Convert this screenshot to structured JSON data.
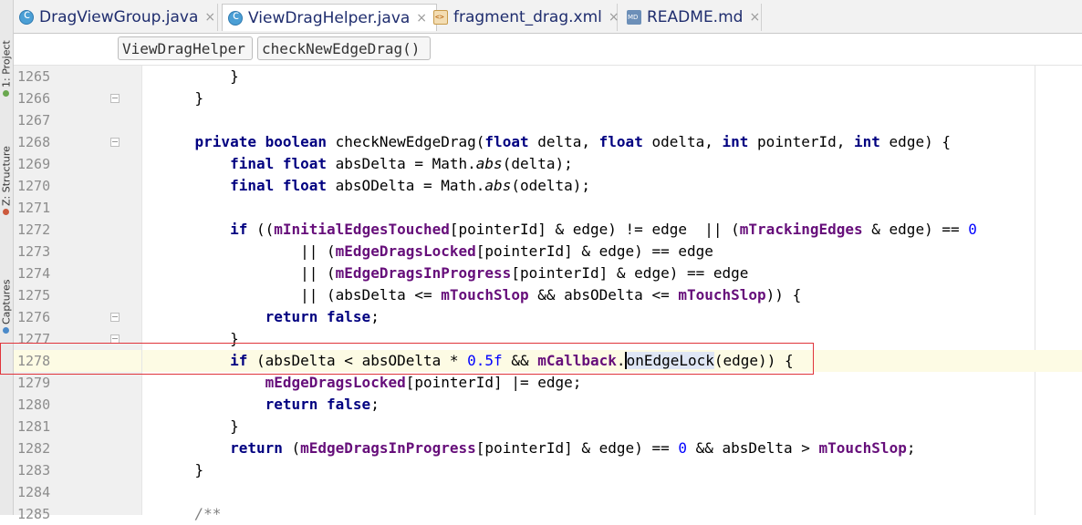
{
  "tool_strip": [
    {
      "label": "1: Project",
      "dot": "#6aa84f"
    },
    {
      "label": "Z: Structure",
      "dot": "#cc5a3d"
    },
    {
      "label": "Captures",
      "dot": "#4b8ac9"
    }
  ],
  "tabs": [
    {
      "label": "DragViewGroup.java",
      "icon": "java-class-icon",
      "active": false,
      "close": "×"
    },
    {
      "label": "ViewDragHelper.java",
      "icon": "java-class-icon",
      "active": true,
      "close": "×"
    },
    {
      "label": "fragment_drag.xml",
      "icon": "xml-file-icon",
      "active": false,
      "close": "×"
    },
    {
      "label": "README.md",
      "icon": "markdown-file-icon",
      "active": false,
      "close": "×"
    }
  ],
  "breadcrumb": [
    "ViewDragHelper",
    "checkNewEdgeDrag()"
  ],
  "editor": {
    "line_numbers": [
      "1265",
      "1266",
      "1267",
      "1268",
      "1269",
      "1270",
      "1271",
      "1272",
      "1273",
      "1274",
      "1275",
      "1276",
      "1277",
      "1278",
      "1279",
      "1280",
      "1281",
      "1282",
      "1283",
      "1284",
      "1285"
    ],
    "current_line": "1278",
    "lines": [
      [
        {
          "t": "        }"
        }
      ],
      [
        {
          "t": "    }"
        }
      ],
      [
        {
          "t": ""
        }
      ],
      [
        {
          "t": "    "
        },
        {
          "t": "private boolean ",
          "c": "kw"
        },
        {
          "t": "checkNewEdgeDrag("
        },
        {
          "t": "float ",
          "c": "kw"
        },
        {
          "t": "delta, "
        },
        {
          "t": "float ",
          "c": "kw"
        },
        {
          "t": "odelta, "
        },
        {
          "t": "int ",
          "c": "kw"
        },
        {
          "t": "pointerId, "
        },
        {
          "t": "int ",
          "c": "kw"
        },
        {
          "t": "edge) {"
        }
      ],
      [
        {
          "t": "        "
        },
        {
          "t": "final float ",
          "c": "kw"
        },
        {
          "t": "absDelta = Math."
        },
        {
          "t": "abs",
          "c": "static"
        },
        {
          "t": "(delta);"
        }
      ],
      [
        {
          "t": "        "
        },
        {
          "t": "final float ",
          "c": "kw"
        },
        {
          "t": "absODelta = Math."
        },
        {
          "t": "abs",
          "c": "static"
        },
        {
          "t": "(odelta);"
        }
      ],
      [
        {
          "t": ""
        }
      ],
      [
        {
          "t": "        "
        },
        {
          "t": "if ",
          "c": "kw"
        },
        {
          "t": "(("
        },
        {
          "t": "mInitialEdgesTouched",
          "c": "fld"
        },
        {
          "t": "[pointerId] & edge) != edge  || ("
        },
        {
          "t": "mTrackingEdges",
          "c": "fld"
        },
        {
          "t": " & edge) == "
        },
        {
          "t": "0",
          "c": "num-lit"
        }
      ],
      [
        {
          "t": "                || ("
        },
        {
          "t": "mEdgeDragsLocked",
          "c": "fld"
        },
        {
          "t": "[pointerId] & edge) == edge"
        }
      ],
      [
        {
          "t": "                || ("
        },
        {
          "t": "mEdgeDragsInProgress",
          "c": "fld"
        },
        {
          "t": "[pointerId] & edge) == edge"
        }
      ],
      [
        {
          "t": "                || (absDelta <= "
        },
        {
          "t": "mTouchSlop",
          "c": "fld"
        },
        {
          "t": " && absODelta <= "
        },
        {
          "t": "mTouchSlop",
          "c": "fld"
        },
        {
          "t": ")) {"
        }
      ],
      [
        {
          "t": "            "
        },
        {
          "t": "return false",
          "c": "kw"
        },
        {
          "t": ";"
        }
      ],
      [
        {
          "t": "        }"
        }
      ],
      [
        {
          "t": "        "
        },
        {
          "t": "if ",
          "c": "kw"
        },
        {
          "t": "(absDelta < absODelta * "
        },
        {
          "t": "0.5f",
          "c": "num-lit"
        },
        {
          "t": " && "
        },
        {
          "t": "mCallback",
          "c": "fld"
        },
        {
          "t": "."
        },
        {
          "t": "onEdgeLock",
          "c": "hl caret"
        },
        {
          "t": "(edge)) {"
        }
      ],
      [
        {
          "t": "            "
        },
        {
          "t": "mEdgeDragsLocked",
          "c": "fld"
        },
        {
          "t": "[pointerId] |= edge;"
        }
      ],
      [
        {
          "t": "            "
        },
        {
          "t": "return false",
          "c": "kw"
        },
        {
          "t": ";"
        }
      ],
      [
        {
          "t": "        }"
        }
      ],
      [
        {
          "t": "        "
        },
        {
          "t": "return ",
          "c": "kw"
        },
        {
          "t": "("
        },
        {
          "t": "mEdgeDragsInProgress",
          "c": "fld"
        },
        {
          "t": "[pointerId] & edge) == "
        },
        {
          "t": "0",
          "c": "num-lit"
        },
        {
          "t": " && absDelta > "
        },
        {
          "t": "mTouchSlop",
          "c": "fld"
        },
        {
          "t": ";"
        }
      ],
      [
        {
          "t": "    }"
        }
      ],
      [
        {
          "t": ""
        }
      ],
      [
        {
          "t": "    "
        },
        {
          "t": "/**",
          "c": "comment"
        }
      ]
    ]
  },
  "colors": {
    "keyword": "#000080",
    "field": "#660e7a",
    "number": "#0000ff",
    "current_line_bg": "#fdfbe4",
    "annotation_box": "#e0343a"
  }
}
